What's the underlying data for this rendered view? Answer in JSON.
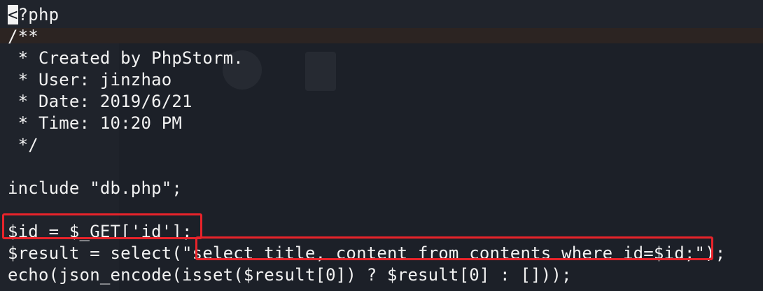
{
  "editor": {
    "lines": [
      {
        "cursor": "<",
        "text": "?php"
      },
      {
        "cursor": "",
        "text": "/**"
      },
      {
        "cursor": "",
        "text": " * Created by PhpStorm."
      },
      {
        "cursor": "",
        "text": " * User: jinzhao"
      },
      {
        "cursor": "",
        "text": " * Date: 2019/6/21"
      },
      {
        "cursor": "",
        "text": " * Time: 10:20 PM"
      },
      {
        "cursor": "",
        "text": " */"
      },
      {
        "cursor": "",
        "text": ""
      },
      {
        "cursor": "",
        "text": "include \"db.php\";"
      },
      {
        "cursor": "",
        "text": ""
      },
      {
        "cursor": "",
        "text": "$id = $_GET['id'];"
      },
      {
        "cursor": "",
        "text": "$result = select(\"select title, content from contents where id=$id;\");"
      },
      {
        "cursor": "",
        "text": "echo(json_encode(isset($result[0]) ? $result[0] : []));"
      }
    ]
  },
  "colors": {
    "background": "#1c2028",
    "text": "#f2f2f2",
    "highlight": "#e8232a"
  }
}
